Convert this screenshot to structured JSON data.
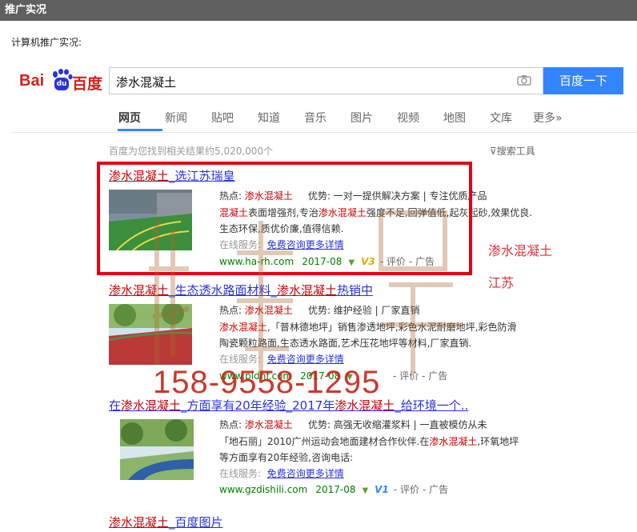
{
  "header": {
    "title": "推广实况"
  },
  "subtitle": "计算机推广实况:",
  "logo": {
    "bai": "Bai",
    "du": "du",
    "cn": "百度"
  },
  "search": {
    "query": "渗水混凝土",
    "button": "百度一下"
  },
  "tabs": [
    "网页",
    "新闻",
    "贴吧",
    "知道",
    "音乐",
    "图片",
    "视频",
    "地图",
    "文库",
    "更多»"
  ],
  "stats": "百度为您找到相关结果约5,020,000个",
  "tools": "搜索工具",
  "results": [
    {
      "title_a": "渗水混凝土",
      "title_b": "_选江苏瑞皇",
      "line1_label": "热点: ",
      "line1_hl": "渗水混凝土",
      "line1_adv": "优势: 一对一提供解决方案 | 专注优质产品",
      "line2_hl": "混凝土",
      "line2_a": "表面增强剂,专治",
      "line2_hl2": "渗水混凝土",
      "line2_b": "强度不足,回弹值低,起灰起砂,效果优良.",
      "line3": "生态环保,质优价廉,值得信赖.",
      "svc": "在线服务:",
      "svc_link": "免费咨询更多详情",
      "url": "www.ha-rh.com",
      "date": "2017-08",
      "v": "V3",
      "rate": "- 评价",
      "ad": "- 广告"
    },
    {
      "title_a": "渗水混凝土",
      "title_b": "_生态透水路面材料_",
      "title_c": "渗水混凝土",
      "title_d": "热销中",
      "line1_label": "热点: ",
      "line1_hl": "渗水混凝土",
      "line1_adv": "优势: 维护经验 | 厂家直销",
      "line2_hl": "渗水混凝土",
      "line2_a": ",「普林德地坪」销售渗透地坪,彩色水泥耐磨地坪,彩色防滑",
      "line3": "陶瓷颗粒路面,生态透水路面,艺术压花地坪等材料,厂家直销.",
      "svc": "在线服务:",
      "svc_link": "免费咨询更多详情",
      "url": "www.pldhf.com",
      "date": "2017-08",
      "rate": "- 评价",
      "ad": "- 广告"
    },
    {
      "title_a": "在",
      "title_b": "渗水混凝土",
      "title_c": "_方面享有20年经验_2017年",
      "title_d": "渗水混凝土",
      "title_e": "_给环境一个..",
      "line1_label": "热点: ",
      "line1_hl": "渗水混凝土",
      "line1_adv": "优势: 高强无收缩灌浆料 | 一直被模仿从未",
      "line2_a": "「地石丽」2010广州运动会地面建材合作伙伴.在",
      "line2_hl": "渗水混凝土",
      "line2_b": ",环氧地坪",
      "line3": "等方面享有20年经验,咨询电话:",
      "svc": "在线服务:",
      "svc_link": "免费咨询更多详情",
      "url": "www.gzdishili.com",
      "date": "2017-08",
      "v": "V1",
      "rate": "- 评价",
      "ad": "- 广告"
    },
    {
      "title_a": "渗水混凝土",
      "title_b": "_百度图片"
    }
  ],
  "annotations": {
    "label1": "渗水混凝土",
    "label2": "江苏",
    "phone": "158-9558-1295"
  },
  "colors": {
    "accent": "#3385ff",
    "highlight": "#e60012",
    "link": "#2932e1",
    "url": "#008000"
  }
}
